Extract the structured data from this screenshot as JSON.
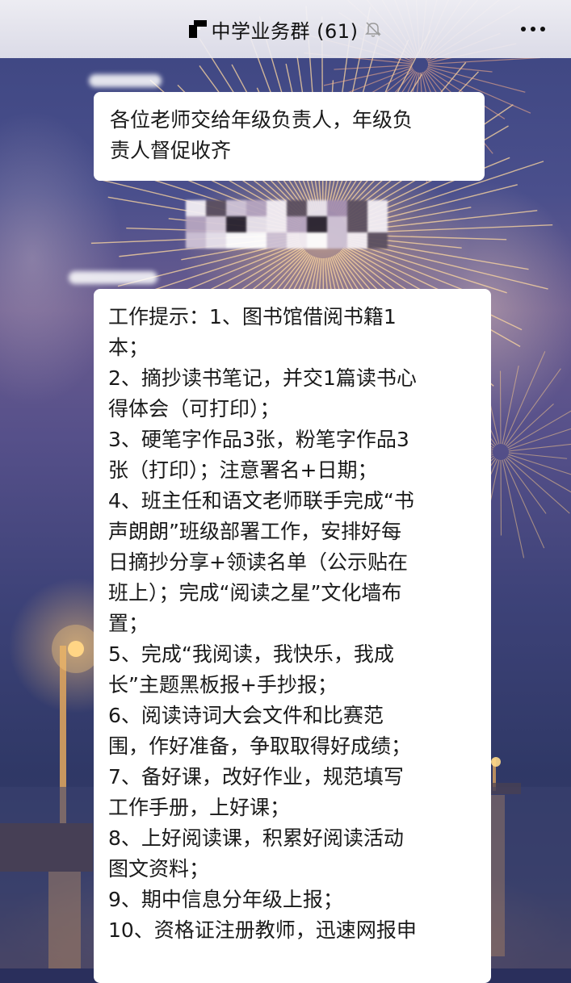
{
  "chat": {
    "title": "中学业务群 (61)"
  },
  "colors": {
    "bubble": "#ffffff",
    "header": "#f3f2f6",
    "text": "#1a1a1a"
  },
  "icons": {
    "title_logo": "qr-logo-icon",
    "mute": "bell-off-icon",
    "more": "more-dots-icon"
  },
  "messages": [
    {
      "type": "text",
      "lines": [
        "各位老师交给年级负责人，年级负",
        "责人督促收齐"
      ]
    },
    {
      "type": "image",
      "content": "pixelated-image"
    },
    {
      "type": "text",
      "lines": [
        "工作提示：1、图书馆借阅书籍1",
        "本；",
        "2、摘抄读书笔记，并交1篇读书心",
        "得体会（可打印）；",
        "3、硬笔字作品3张，粉笔字作品3",
        "张（打印）；注意署名+日期；",
        "4、班主任和语文老师联手完成“书",
        "声朗朗”班级部署工作，安排好每",
        "日摘抄分享+领读名单（公示贴在",
        "班上）；完成“阅读之星”文化墙布",
        "置；",
        "5、完成“我阅读，我快乐，我成",
        "长”主题黑板报+手抄报；",
        "6、阅读诗词大会文件和比赛范",
        "围，作好准备，争取取得好成绩；",
        "7、备好课，改好作业，规范填写",
        "工作手册，上好课；",
        "8、上好阅读课，积累好阅读活动",
        "图文资料；",
        "9、期中信息分年级上报；",
        "10、资格证注册教师，迅速网报申"
      ]
    }
  ]
}
